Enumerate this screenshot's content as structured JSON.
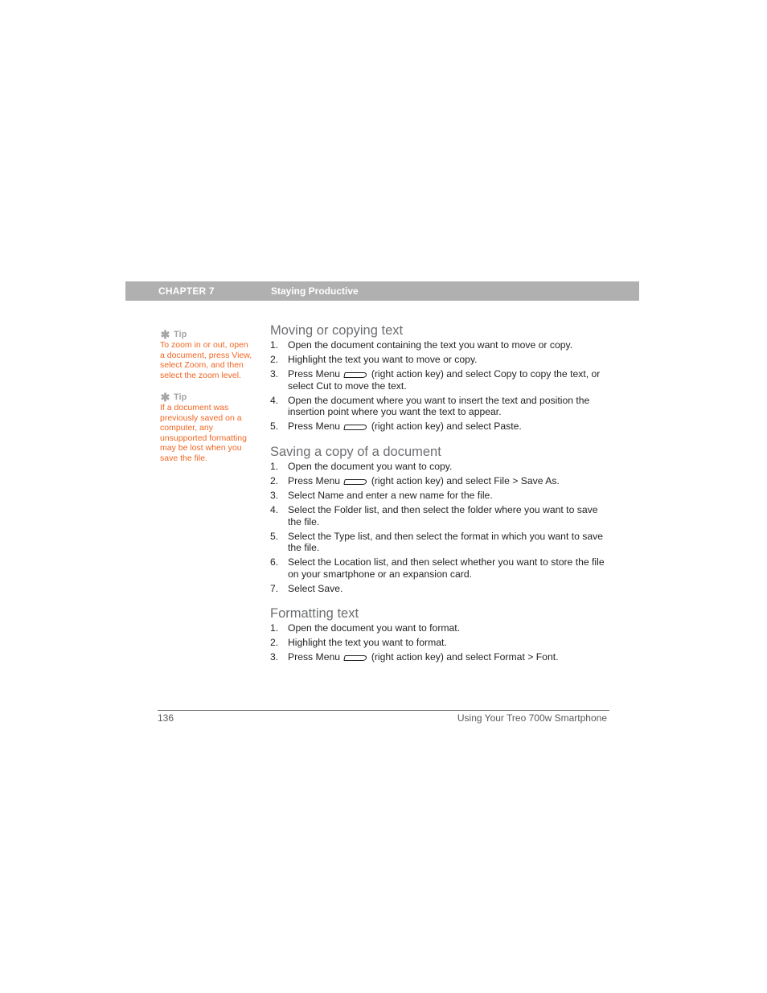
{
  "header": {
    "chapter_label": "CHAPTER 7",
    "chapter_title": "Staying Productive",
    "bar_color": "#b0b0b0"
  },
  "sidebar": {
    "tips": [
      {
        "icon": "asterisk-icon",
        "label": "Tip",
        "text": "To zoom in or out, open a document, press View, select Zoom, and then select the zoom level."
      },
      {
        "icon": "asterisk-icon",
        "label": "Tip",
        "text": "If a document was previously saved on a computer, any unsupported formatting may be lost when you save the file."
      }
    ],
    "tip_color": "#f26522"
  },
  "sections": [
    {
      "title": "Moving or copying text",
      "steps": [
        {
          "num": "1.",
          "text": "Open the document containing the text you want to move or copy."
        },
        {
          "num": "2.",
          "text": "Highlight the text you want to move or copy."
        },
        {
          "num": "3.",
          "before": "Press Menu",
          "after": "(right action key) and select Copy to copy the text, or select Cut to move the text."
        },
        {
          "num": "4.",
          "text": "Open the document where you want to insert the text and position the insertion point where you want the text to appear."
        },
        {
          "num": "5.",
          "before": "Press Menu",
          "after": "(right action key) and select Paste."
        }
      ]
    },
    {
      "title": "Saving a copy of a document",
      "steps": [
        {
          "num": "1.",
          "text": "Open the document you want to copy."
        },
        {
          "num": "2.",
          "before": "Press Menu",
          "after": "(right action key) and select File > Save As."
        },
        {
          "num": "3.",
          "text": "Select Name and enter a new name for the file."
        },
        {
          "num": "4.",
          "text": "Select the Folder list, and then select the folder where you want to save the file."
        },
        {
          "num": "5.",
          "text": "Select the Type list, and then select the format in which you want to save the file."
        },
        {
          "num": "6.",
          "text": "Select the Location list, and then select whether you want to store the file on your smartphone or an expansion card."
        },
        {
          "num": "7.",
          "text": "Select Save."
        }
      ]
    },
    {
      "title": "Formatting text",
      "steps": [
        {
          "num": "1.",
          "text": "Open the document you want to format."
        },
        {
          "num": "2.",
          "text": "Highlight the text you want to format."
        },
        {
          "num": "3.",
          "before": "Press Menu",
          "after": "(right action key) and select Format > Font."
        }
      ]
    }
  ],
  "footer": {
    "page_number": "136",
    "book_title": "Using Your Treo 700w Smartphone"
  }
}
